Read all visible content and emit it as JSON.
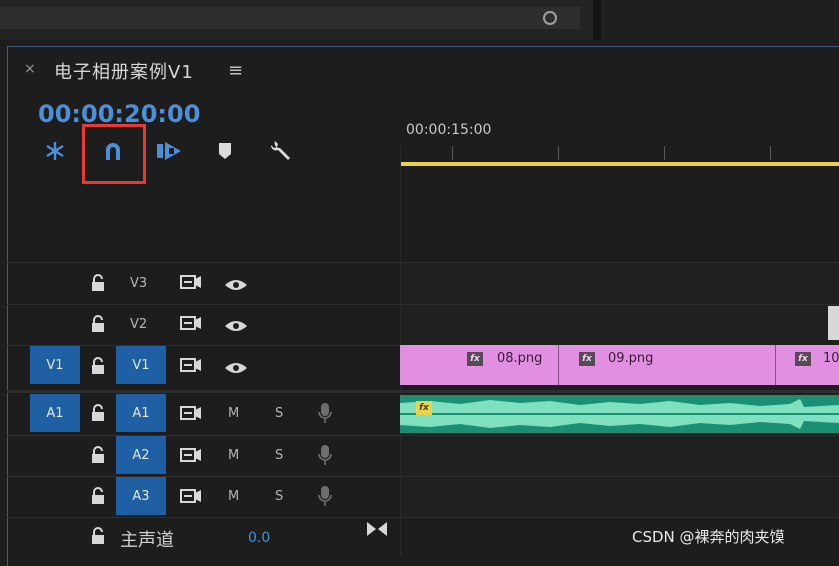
{
  "sequence": {
    "close_glyph": "×",
    "title": "电子相册案例V1",
    "menu_glyph": "≡",
    "timecode": "00:00:20:00"
  },
  "ruler": {
    "time_label": "00:00:15:00"
  },
  "tracks": {
    "video": [
      {
        "target": "",
        "name": "V3"
      },
      {
        "target": "",
        "name": "V2"
      },
      {
        "target": "V1",
        "name": "V1"
      }
    ],
    "audio": [
      {
        "target": "A1",
        "name": "A1",
        "m": "M",
        "s": "S"
      },
      {
        "target": "",
        "name": "A2",
        "m": "M",
        "s": "S"
      },
      {
        "target": "",
        "name": "A3",
        "m": "M",
        "s": "S"
      }
    ],
    "master": {
      "label": "主声道",
      "value": "0.0"
    }
  },
  "clips": [
    {
      "fx": "fx",
      "name": "08.png"
    },
    {
      "fx": "fx",
      "name": "09.png"
    },
    {
      "fx": "fx",
      "name": "10"
    }
  ],
  "audio_fx": "fx",
  "watermark": "CSDN @裸奔的肉夹馍",
  "colors": {
    "accent": "#4a8fd8",
    "highlight": "#e53a36",
    "clip": "#e18fe0",
    "audio": "#1a8f72",
    "playhead": "#e8d44a"
  }
}
